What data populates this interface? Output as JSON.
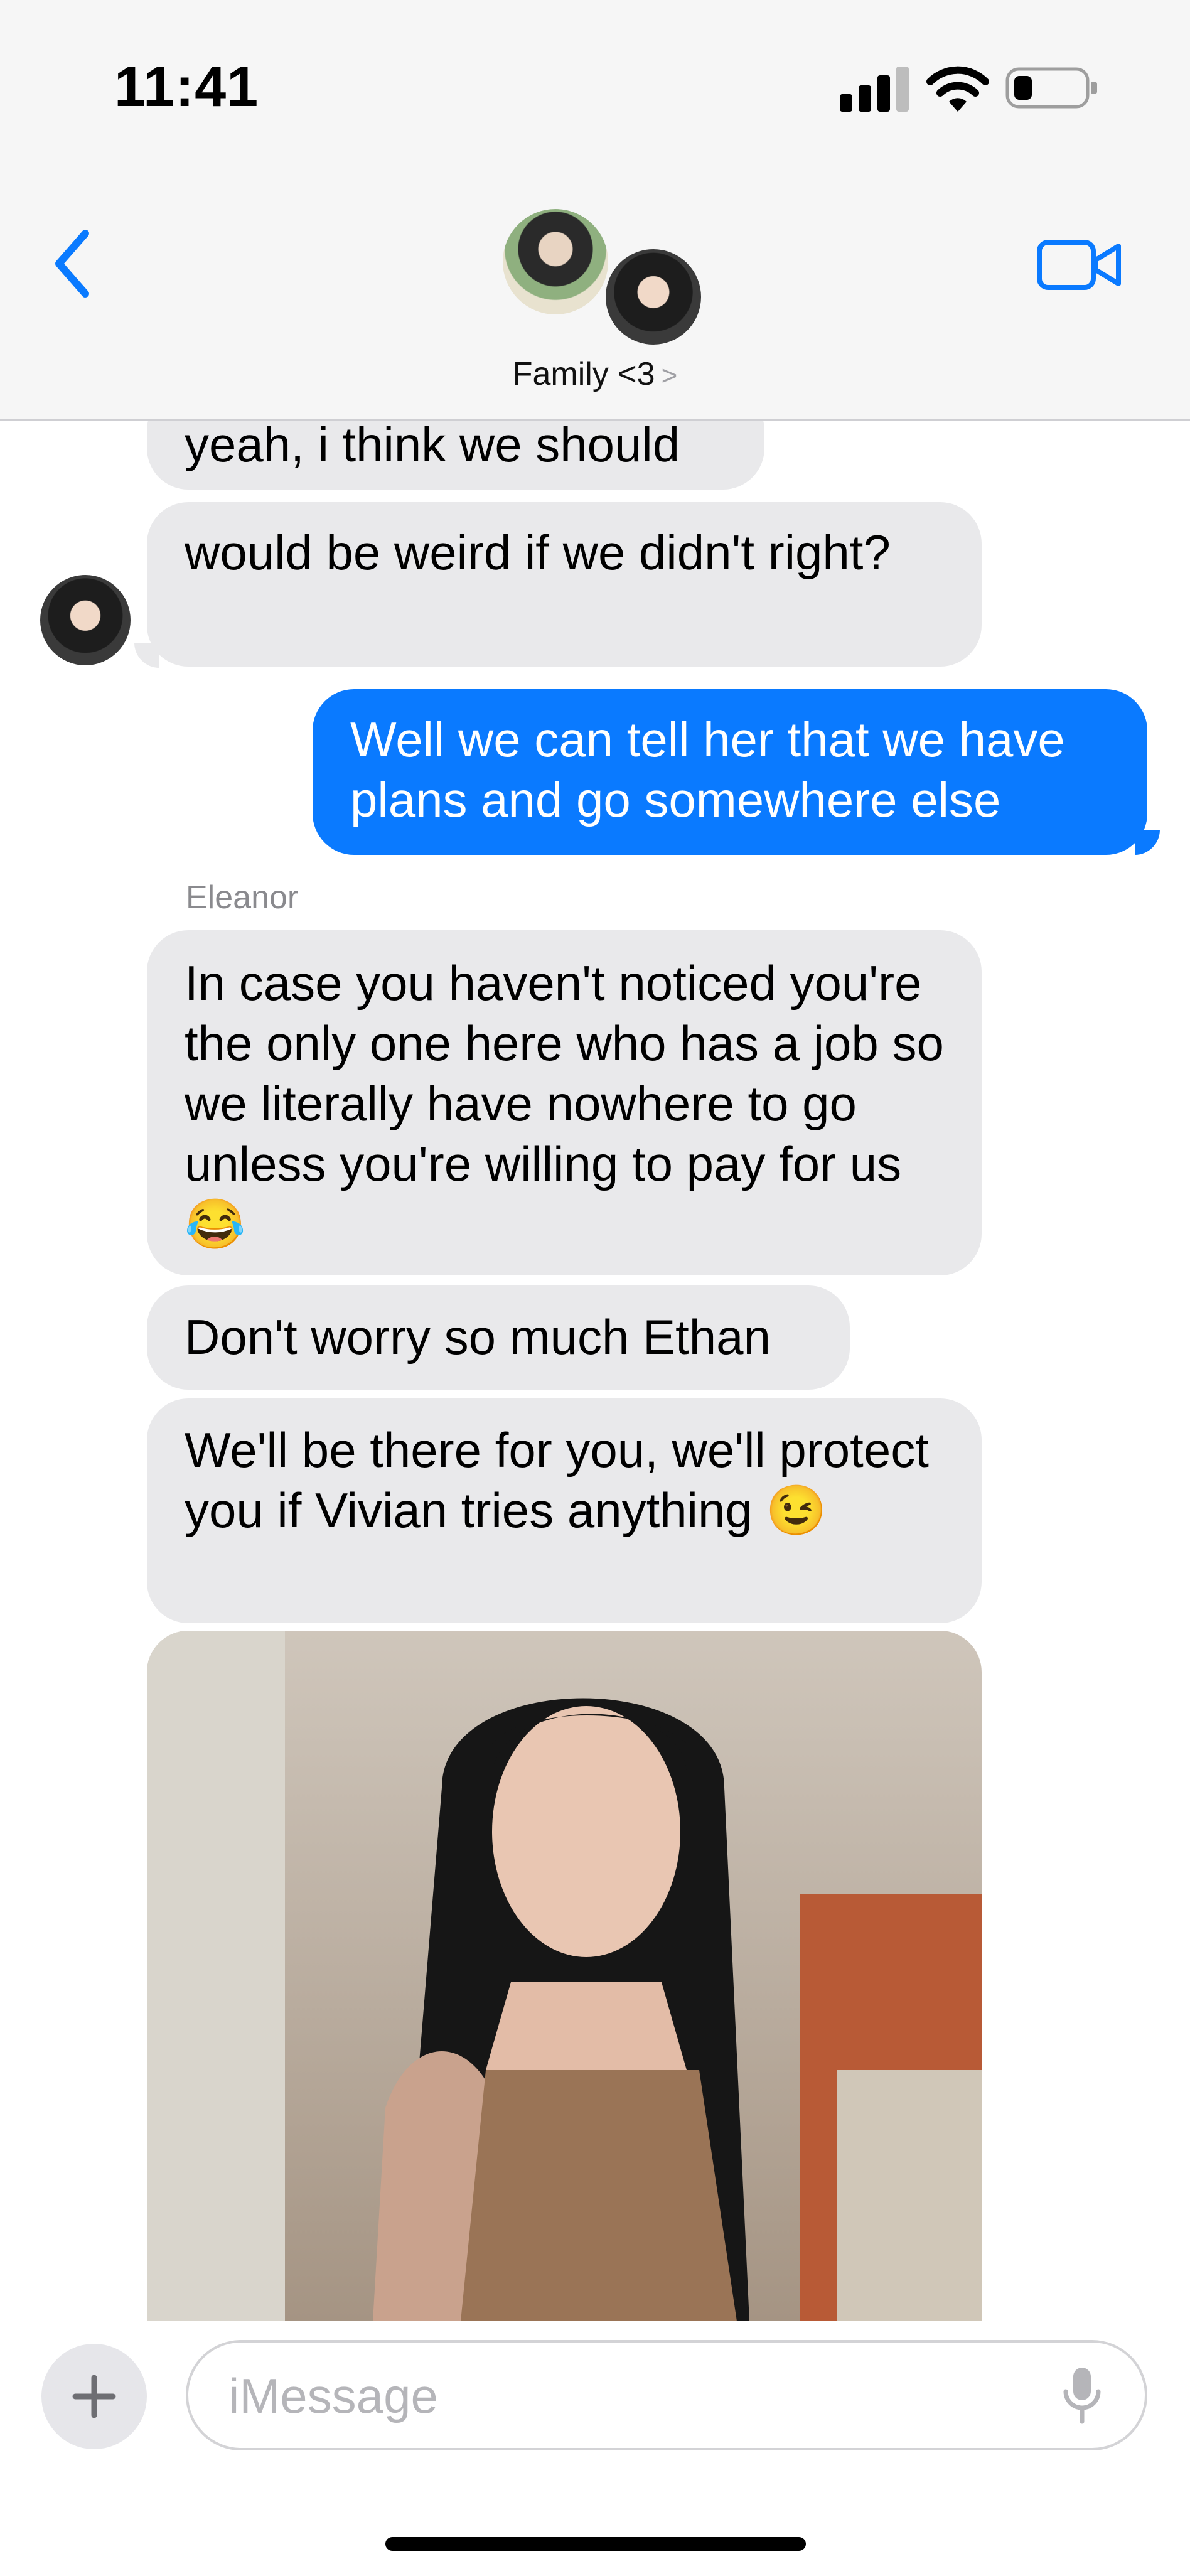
{
  "status_bar": {
    "time": "11:41"
  },
  "header": {
    "group_name": "Family <3",
    "chevron": ">"
  },
  "messages": [
    {
      "side": "in",
      "text": "yeah, i think we should"
    },
    {
      "side": "in",
      "text": "would be weird if we didn't right?"
    },
    {
      "side": "out",
      "text": "Well we can tell her that we have plans and go somewhere else"
    },
    {
      "side": "in",
      "sender": "Eleanor",
      "text": "In case you haven't noticed you're the only one here who has a job so we literally have nowhere to go unless you're willing to pay for us 😂"
    },
    {
      "side": "in",
      "text": "Don't worry so much Ethan"
    },
    {
      "side": "in",
      "text": "We'll be there for you, we'll protect you if Vivian tries anything 😉"
    }
  ],
  "composer": {
    "placeholder": "iMessage"
  },
  "colors": {
    "accent": "#0a7aff",
    "incoming_bubble": "#e9e9eb"
  },
  "icons": [
    "back-chevron-icon",
    "video-camera-icon",
    "plus-icon",
    "microphone-icon",
    "signal-icon",
    "wifi-icon",
    "battery-icon"
  ]
}
